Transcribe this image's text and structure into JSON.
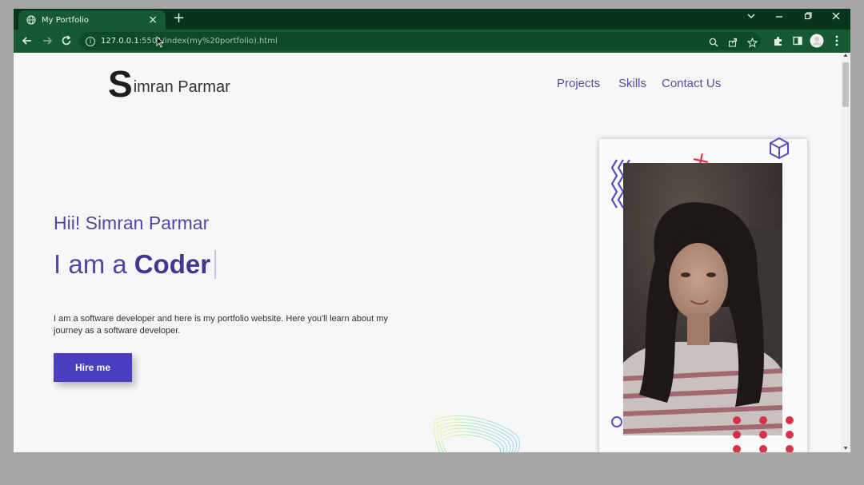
{
  "browser": {
    "tab_title": "My Portfolio",
    "tab_close": "×",
    "new_tab": "+",
    "url_host": "127.0.0.1",
    "url_rest": ":5501/index(my%20portfolio).html",
    "icons": [
      "globe-icon",
      "back-arrow-icon",
      "forward-arrow-icon",
      "reload-icon",
      "info-icon",
      "zoom-icon",
      "share-icon",
      "bookmark-star-icon",
      "extensions-icon",
      "side-panel-icon",
      "profile-avatar-icon",
      "menu-kebab-icon",
      "chevron-down-icon",
      "minimize-icon",
      "restore-icon",
      "close-icon"
    ],
    "colors": {
      "frame": "#07351a",
      "toolbar": "#155a32"
    }
  },
  "site": {
    "logo_initial": "S",
    "logo_rest": "imran Parmar",
    "nav": {
      "projects": "Projects",
      "skills": "Skills",
      "contact": "Contact Us"
    },
    "hero": {
      "greeting": "Hii! Simran Parmar",
      "prefix": "I am a",
      "role": "Coder",
      "description": "I am a software developer and here is my portfolio website. Here you'll learn about my journey as a software developer.",
      "cta": "Hire me"
    },
    "colors": {
      "accent": "#4c3fbf",
      "text_purple": "#5147a3",
      "decor_red": "#d6334a"
    }
  }
}
